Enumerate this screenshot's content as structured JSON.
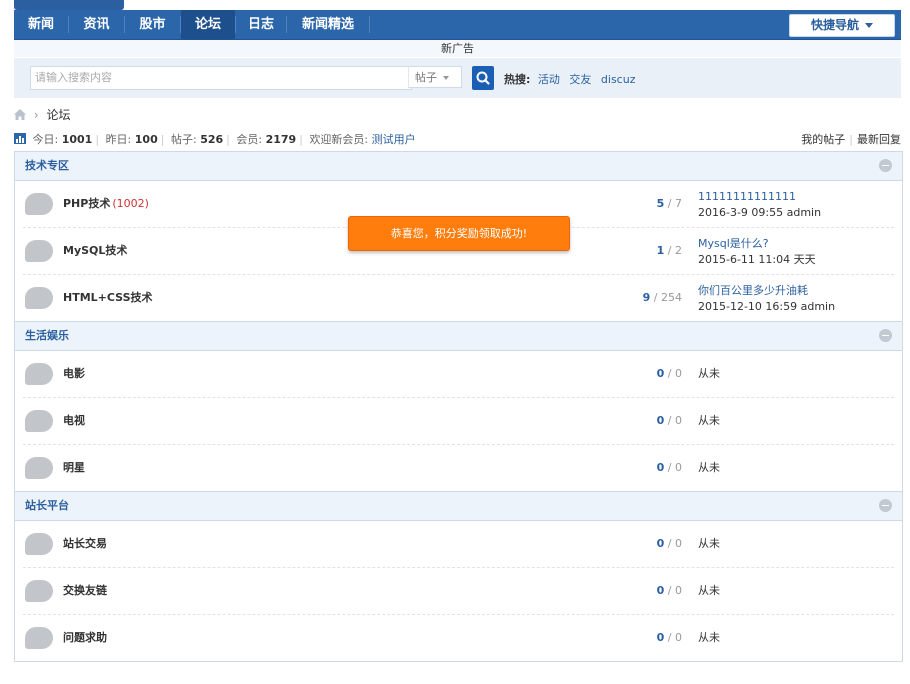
{
  "nav": {
    "items": [
      "新闻",
      "资讯",
      "股市",
      "论坛",
      "日志",
      "新闻精选"
    ],
    "active": "论坛",
    "quick_nav": "快捷导航"
  },
  "ad_text": "新广告",
  "search": {
    "placeholder": "请输入搜索内容",
    "type": "帖子",
    "hot_label": "热搜:",
    "hot_words": [
      "活动",
      "交友",
      "discuz"
    ]
  },
  "breadcrumb": {
    "current": "论坛"
  },
  "stats": {
    "today_label": "今日:",
    "today": "1001",
    "yesterday_label": "昨日:",
    "yesterday": "100",
    "posts_label": "帖子:",
    "posts": "526",
    "members_label": "会员:",
    "members": "2179",
    "welcome_label": "欢迎新会员:",
    "new_member": "测试用户",
    "my_posts": "我的帖子",
    "latest_replies": "最新回复"
  },
  "categories": [
    {
      "name": "技术专区",
      "forums": [
        {
          "name": "PHP技术",
          "today": "(1002)",
          "threads": "5",
          "posts": "7",
          "last_title": "11111111111111",
          "last_meta": "2016-3-9 09:55 admin"
        },
        {
          "name": "MySQL技术",
          "threads": "1",
          "posts": "2",
          "last_title": "Mysql是什么?",
          "last_meta": "2015-6-11 11:04 天天"
        },
        {
          "name": "HTML+CSS技术",
          "threads": "9",
          "posts": "254",
          "last_title": "你们百公里多少升油耗",
          "last_meta": "2015-12-10 16:59 admin"
        }
      ]
    },
    {
      "name": "生活娱乐",
      "forums": [
        {
          "name": "电影",
          "threads": "0",
          "posts": "0",
          "never": "从未"
        },
        {
          "name": "电视",
          "threads": "0",
          "posts": "0",
          "never": "从未"
        },
        {
          "name": "明星",
          "threads": "0",
          "posts": "0",
          "never": "从未"
        }
      ]
    },
    {
      "name": "站长平台",
      "forums": [
        {
          "name": "站长交易",
          "threads": "0",
          "posts": "0",
          "never": "从未"
        },
        {
          "name": "交换友链",
          "threads": "0",
          "posts": "0",
          "never": "从未"
        },
        {
          "name": "问题求助",
          "threads": "0",
          "posts": "0",
          "never": "从未"
        }
      ]
    }
  ],
  "toast": "恭喜您，积分奖励领取成功!",
  "colors": {
    "nav": "#2b66aa",
    "link": "#2b5f9f",
    "toast": "#ff7d0c",
    "category_bg": "#edf3fa"
  }
}
